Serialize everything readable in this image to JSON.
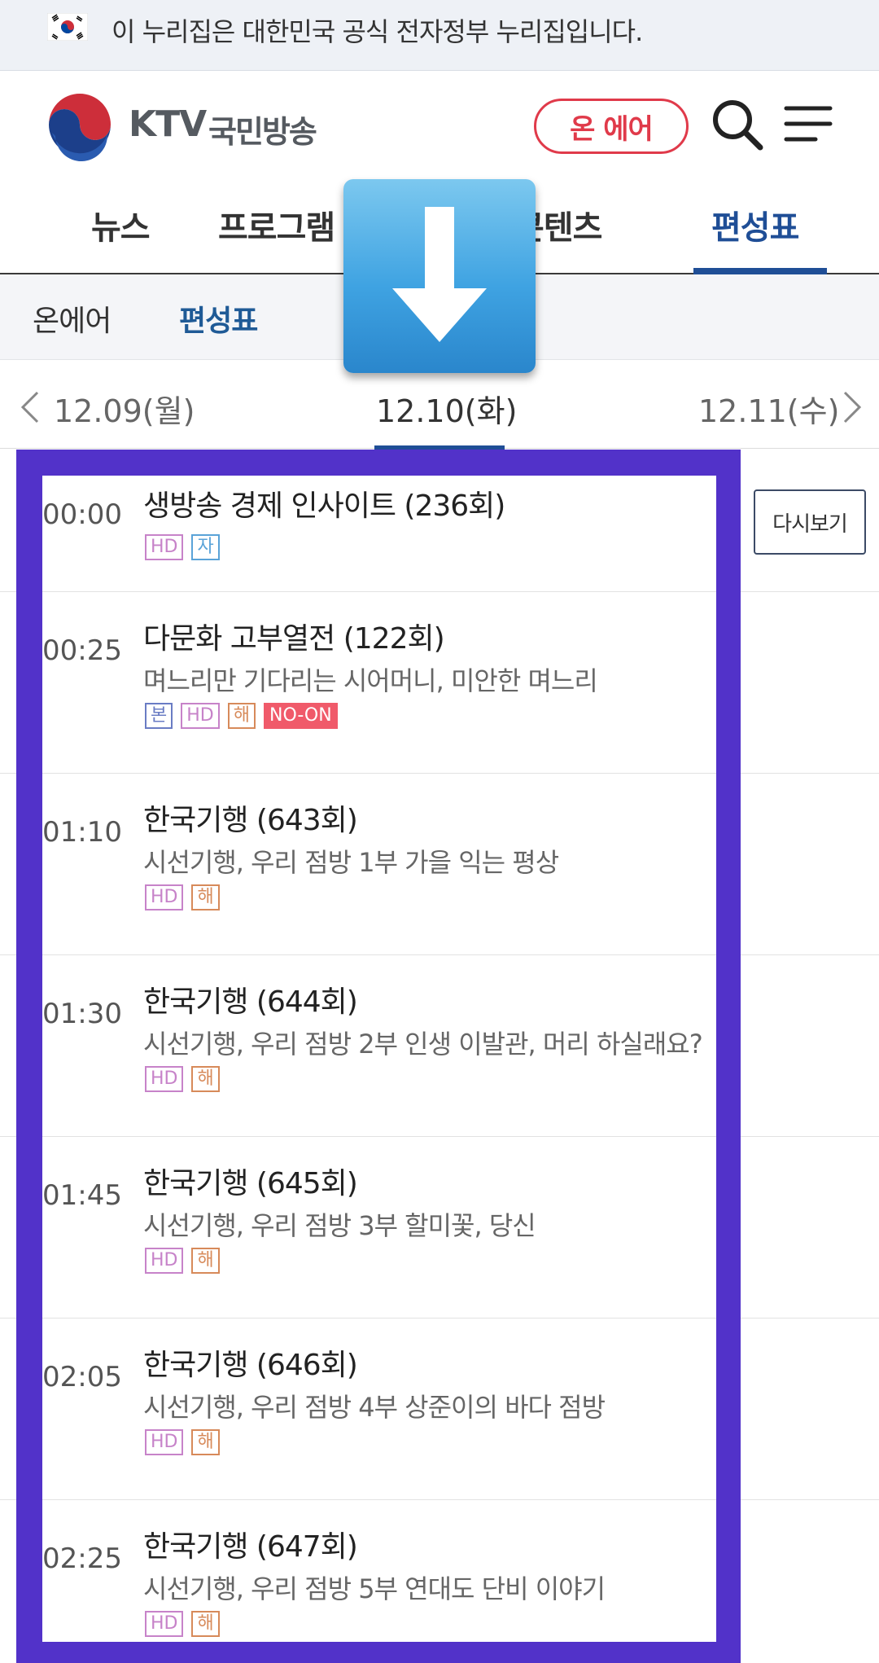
{
  "gov_banner": {
    "text": "이 누리집은 대한민국 공식 전자정부 누리집입니다."
  },
  "header": {
    "logo_ktv": "KTV",
    "logo_name": "국민방송",
    "onair_label": "온 에어"
  },
  "main_nav": {
    "items": [
      {
        "label": "뉴스"
      },
      {
        "label": "프로그램"
      },
      {
        "label": "콘텐츠"
      },
      {
        "label": "편성표",
        "active": true
      }
    ]
  },
  "sub_nav": {
    "items": [
      {
        "label": "온에어"
      },
      {
        "label": "편성표",
        "active": true
      }
    ]
  },
  "date_bar": {
    "prev": "12.09(월)",
    "current": "12.10(화)",
    "next": "12.11(수)"
  },
  "rewatch_label": "다시보기",
  "schedule": [
    {
      "time": "00:00",
      "title": "생방송 경제 인사이트 (236회)",
      "desc": "",
      "tags": [
        "HD",
        "자"
      ]
    },
    {
      "time": "00:25",
      "title": "다문화 고부열전 (122회)",
      "desc": "며느리만 기다리는 시어머니, 미안한 며느리",
      "tags": [
        "본",
        "HD",
        "해",
        "NO-ON"
      ]
    },
    {
      "time": "01:10",
      "title": "한국기행 (643회)",
      "desc": "시선기행, 우리 점방 1부 가을 익는 평상",
      "tags": [
        "HD",
        "해"
      ]
    },
    {
      "time": "01:30",
      "title": "한국기행 (644회)",
      "desc": "시선기행, 우리 점방 2부 인생 이발관, 머리 하실래요?",
      "tags": [
        "HD",
        "해"
      ]
    },
    {
      "time": "01:45",
      "title": "한국기행 (645회)",
      "desc": "시선기행, 우리 점방 3부 할미꽃, 당신",
      "tags": [
        "HD",
        "해"
      ]
    },
    {
      "time": "02:05",
      "title": "한국기행 (646회)",
      "desc": "시선기행, 우리 점방 4부 상준이의 바다 점방",
      "tags": [
        "HD",
        "해"
      ]
    },
    {
      "time": "02:25",
      "title": "한국기행 (647회)",
      "desc": "시선기행, 우리 점방 5부 연대도 단비 이야기",
      "tags": [
        "HD",
        "해"
      ]
    }
  ],
  "colors": {
    "accent_blue": "#1f4e96",
    "onair_red": "#e03a4a",
    "frame_purple": "#5232c9"
  },
  "icons": [
    "korea-flag-icon",
    "ktv-logo-icon",
    "search-icon",
    "hamburger-menu-icon",
    "chevron-left-icon",
    "chevron-right-icon",
    "scroll-down-arrow-icon"
  ]
}
